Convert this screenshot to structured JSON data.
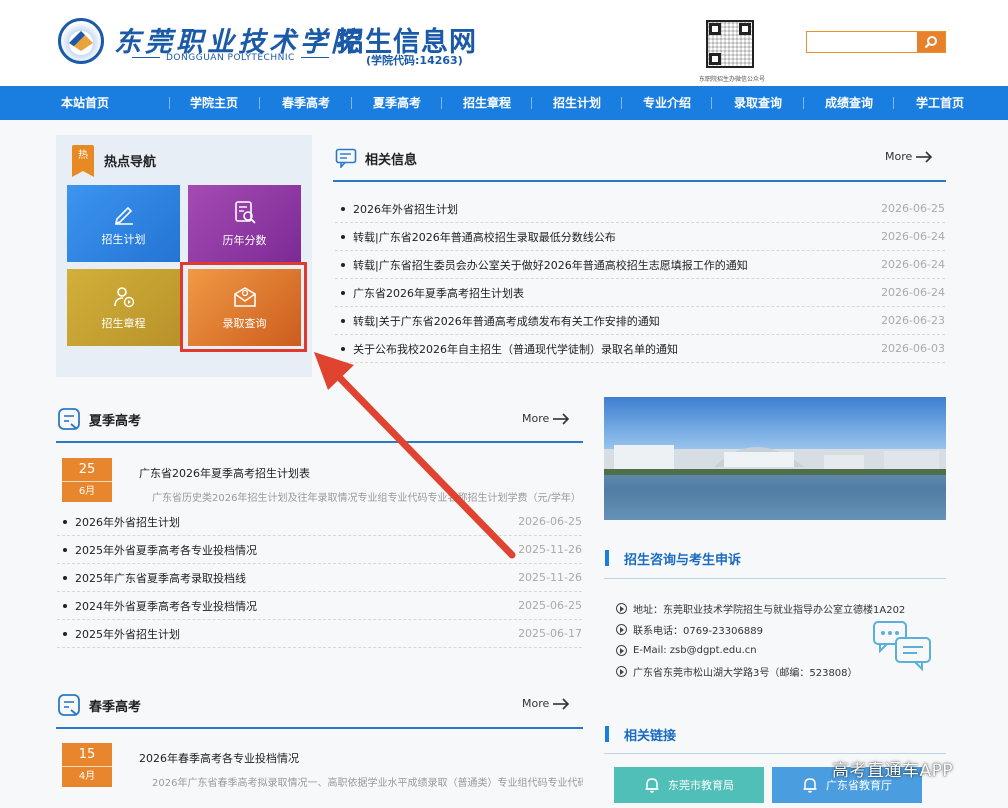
{
  "header": {
    "school_name_cn": "东莞职业技术学院",
    "school_name_en": "DONGGUAN POLYTECHNIC",
    "separator": "·",
    "site_title": "招生信息网",
    "school_code": "(学院代码:14263)",
    "qr_caption": "东职院招生办微信公众号",
    "search_placeholder": ""
  },
  "nav": [
    "本站首页",
    "学院主页",
    "春季高考",
    "夏季高考",
    "招生章程",
    "招生计划",
    "专业介绍",
    "录取查询",
    "成绩查询",
    "学工首页"
  ],
  "hot_nav": {
    "badge": "热",
    "title": "热点导航",
    "tiles": [
      {
        "label": "招生计划",
        "icon": "pencil-icon",
        "color": "#2f86e6"
      },
      {
        "label": "历年分数",
        "icon": "doc-search-icon",
        "color": "#9a3aa8"
      },
      {
        "label": "招生章程",
        "icon": "person-play-icon",
        "color": "#c9a52e"
      },
      {
        "label": "录取查询",
        "icon": "mail-check-icon",
        "color": "#e0762a"
      }
    ]
  },
  "related_info": {
    "title": "相关信息",
    "more": "More",
    "items": [
      {
        "title": "2026年外省招生计划",
        "date": "2026-06-25"
      },
      {
        "title": "转载|广东省2026年普通高校招生录取最低分数线公布",
        "date": "2026-06-24"
      },
      {
        "title": "转载|广东省招生委员会办公室关于做好2026年普通高校招生志愿填报工作的通知",
        "date": "2026-06-24"
      },
      {
        "title": "广东省2026年夏季高考招生计划表",
        "date": "2026-06-24"
      },
      {
        "title": "转载|关于广东省2026年普通高考成绩发布有关工作安排的通知",
        "date": "2026-06-23"
      },
      {
        "title": "关于公布我校2026年自主招生（普通现代学徒制）录取名单的通知",
        "date": "2026-06-03"
      }
    ]
  },
  "summer": {
    "title": "夏季高考",
    "more": "More",
    "featured": {
      "day": "25",
      "month": "6月",
      "title": "广东省2026年夏季高考招生计划表",
      "summary": "广东省历史类2026年招生计划及往年录取情况专业组专业代码专业名称招生计划学费（元/学年）"
    },
    "items": [
      {
        "title": "2026年外省招生计划",
        "date": "2026-06-25"
      },
      {
        "title": "2025年外省夏季高考各专业投档情况",
        "date": "2025-11-26"
      },
      {
        "title": "2025年广东省夏季高考录取投档线",
        "date": "2025-11-26"
      },
      {
        "title": "2024年外省夏季高考各专业投档情况",
        "date": "2025-06-25"
      },
      {
        "title": "2025年外省招生计划",
        "date": "2025-06-17"
      }
    ]
  },
  "spring": {
    "title": "春季高考",
    "more": "More",
    "featured": {
      "day": "15",
      "month": "4月",
      "title": "2026年春季高考各专业投档情况",
      "summary": "2026年广东省春季高考拟录取情况一、高职依据学业水平成绩录取（普通类）专业组代码专业代码..."
    }
  },
  "consult": {
    "title": "招生咨询与考生申诉",
    "lines": [
      "地址：东莞职业技术学院招生与就业指导办公室立德楼1A202",
      "联系电话：0769-23306889",
      "E-Mail: zsb@dgpt.edu.cn",
      "广东省东莞市松山湖大学路3号（邮编：523808）"
    ]
  },
  "links": {
    "title": "相关链接",
    "buttons": [
      {
        "label": "东莞市教育局",
        "color": "#4fbfb8"
      },
      {
        "label": "广东省教育厅",
        "color": "#4a9ee0"
      }
    ]
  },
  "watermark": "高考直通车APP"
}
